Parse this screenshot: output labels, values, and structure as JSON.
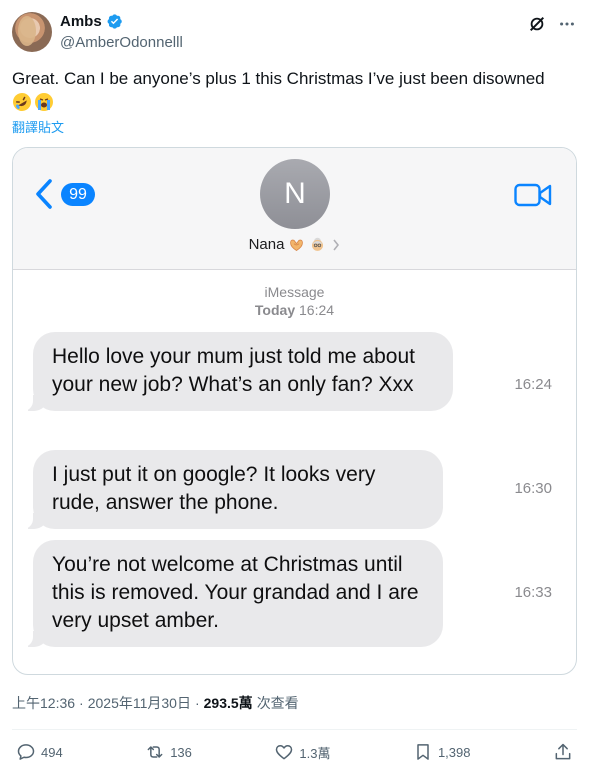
{
  "author": {
    "display_name": "Ambs",
    "handle": "@AmberOdonnelll",
    "verified_icon": "verified-badge-icon"
  },
  "tweet": {
    "text": "Great. Can I be anyone’s plus 1 this Christmas I’ve just been disowned",
    "emojis": [
      "rolling-on-floor-laughing-emoji",
      "loudly-crying-emoji"
    ],
    "translate_label": "翻譯貼文"
  },
  "media": {
    "back_count": "99",
    "contact_initial": "N",
    "contact_name": "Nana",
    "contact_emojis": [
      "heart-hands-emoji",
      "old-woman-emoji"
    ],
    "service_label": "iMessage",
    "service_day": "Today",
    "service_time": "16:24",
    "messages": [
      {
        "text": "Hello love your mum just told me about your new job? What’s an only fan? Xxx",
        "time": "16:24"
      },
      {
        "text": "I just put it on google? It looks very rude, answer the phone.",
        "time": "16:30"
      },
      {
        "text": "You’re not welcome at Christmas until this is removed. Your grandad and I are very upset amber.",
        "time": "16:33"
      }
    ],
    "colors": {
      "bubble": "#e9e9eb",
      "ios_blue": "#0a84ff"
    }
  },
  "meta": {
    "time": "上午12:36",
    "separator": "·",
    "date": "2025年11月30日",
    "views": "293.5萬",
    "views_label": "次查看"
  },
  "actions": {
    "replies": "494",
    "reposts": "136",
    "likes": "1.3萬",
    "bookmarks": "1,398"
  },
  "colors": {
    "accent": "#1d9bf0",
    "text": "#0f1419",
    "muted": "#536471"
  }
}
